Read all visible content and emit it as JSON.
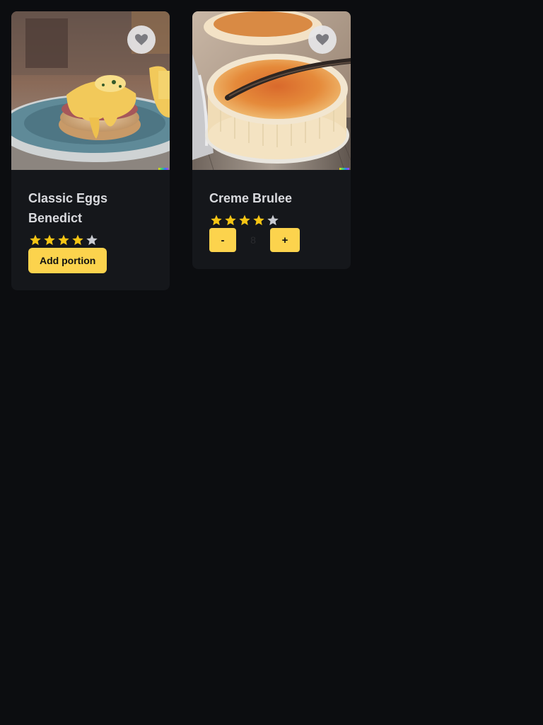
{
  "colors": {
    "background": "#0c0d10",
    "card": "#15171b",
    "accent": "#fcd34d",
    "star_filled": "#f6c514",
    "star_empty": "#c9cbd1",
    "title_text": "#d9dade"
  },
  "cards": [
    {
      "title": "Classic Eggs Benedict",
      "image_subject": "eggs benedict on english muffin with hollandaise",
      "favorite_icon": "heart-icon",
      "rating": 4,
      "rating_max": 5,
      "action": {
        "label": "Add portion"
      }
    },
    {
      "title": "Creme Brulee",
      "image_subject": "creme brulee ramekin with vanilla bean",
      "favorite_icon": "heart-icon",
      "rating": 4,
      "rating_max": 5,
      "stepper": {
        "minus_label": "-",
        "quantity": "8",
        "plus_label": "+"
      }
    }
  ]
}
